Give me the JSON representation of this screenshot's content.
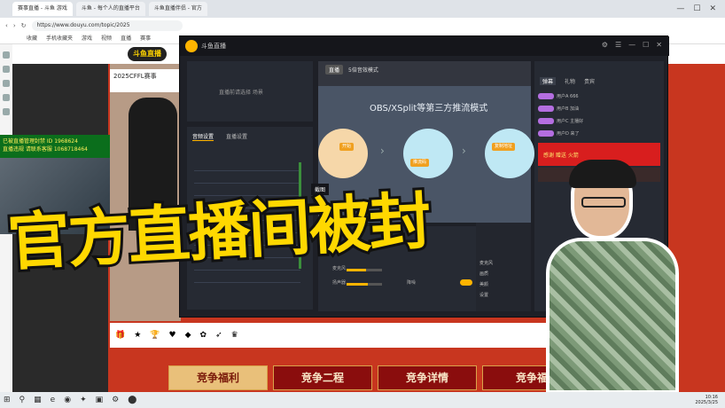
{
  "browser": {
    "tabs": [
      "赛事直播 - 斗鱼 游戏",
      "斗鱼 - 每个人的直播平台",
      "斗鱼直播伴侣 - 官方"
    ],
    "url": "https://www.douyu.com/topic/2025",
    "bookmarks": [
      "收藏",
      "手机收藏夹",
      "游戏",
      "视频",
      "直播",
      "赛事"
    ],
    "window_controls": [
      "—",
      "☐",
      "✕"
    ]
  },
  "site": {
    "logo": "斗鱼直播",
    "live_title": "2025CFFL赛事",
    "cam_overlay": [
      "已被直播管理封禁 ID 1968624",
      "直播违规 请联系客服 1068718464"
    ]
  },
  "app": {
    "name": "斗鱼直播",
    "window_icons": [
      "⚙",
      "☰",
      "—",
      "☐",
      "✕"
    ],
    "preview_panel": "直播前请选择 场景",
    "mixer_tabs": [
      "音频设置",
      "直播设置"
    ],
    "preview_badge": "直播",
    "preview_title": "5倍音效模式",
    "preview_center_text": "OBS/XSplit等第三方推流模式",
    "preview_buttons": [
      "开始",
      "推流码",
      "复制地址"
    ],
    "screenshot_label": "截图",
    "controls": [
      {
        "label": "麦克风",
        "value": 0.55
      },
      {
        "label": "扬声器",
        "value": 0.6
      },
      {
        "label": "降噪",
        "value": 0.4
      }
    ],
    "right_mid_items": [
      "麦克风",
      "画质",
      "美颜",
      "设置"
    ],
    "side_tabs": [
      "弹幕",
      "礼物",
      "贵宾"
    ],
    "chat_rows": [
      "用户A 666",
      "用户B 加油",
      "用户C 主播好",
      "用户D 来了"
    ],
    "gift_banner": "感谢 赠送 火箭"
  },
  "stage_buttons": [
    "竞争福利",
    "竞争二程",
    "竞争详情",
    "竞争福"
  ],
  "caption": "官方直播间被封",
  "taskbar": {
    "icons": [
      "⊞",
      "⚲",
      "▦",
      "e",
      "◉",
      "✦",
      "▣",
      "⚙",
      "⬤"
    ],
    "time": "10:16",
    "date": "2025/3/25"
  }
}
